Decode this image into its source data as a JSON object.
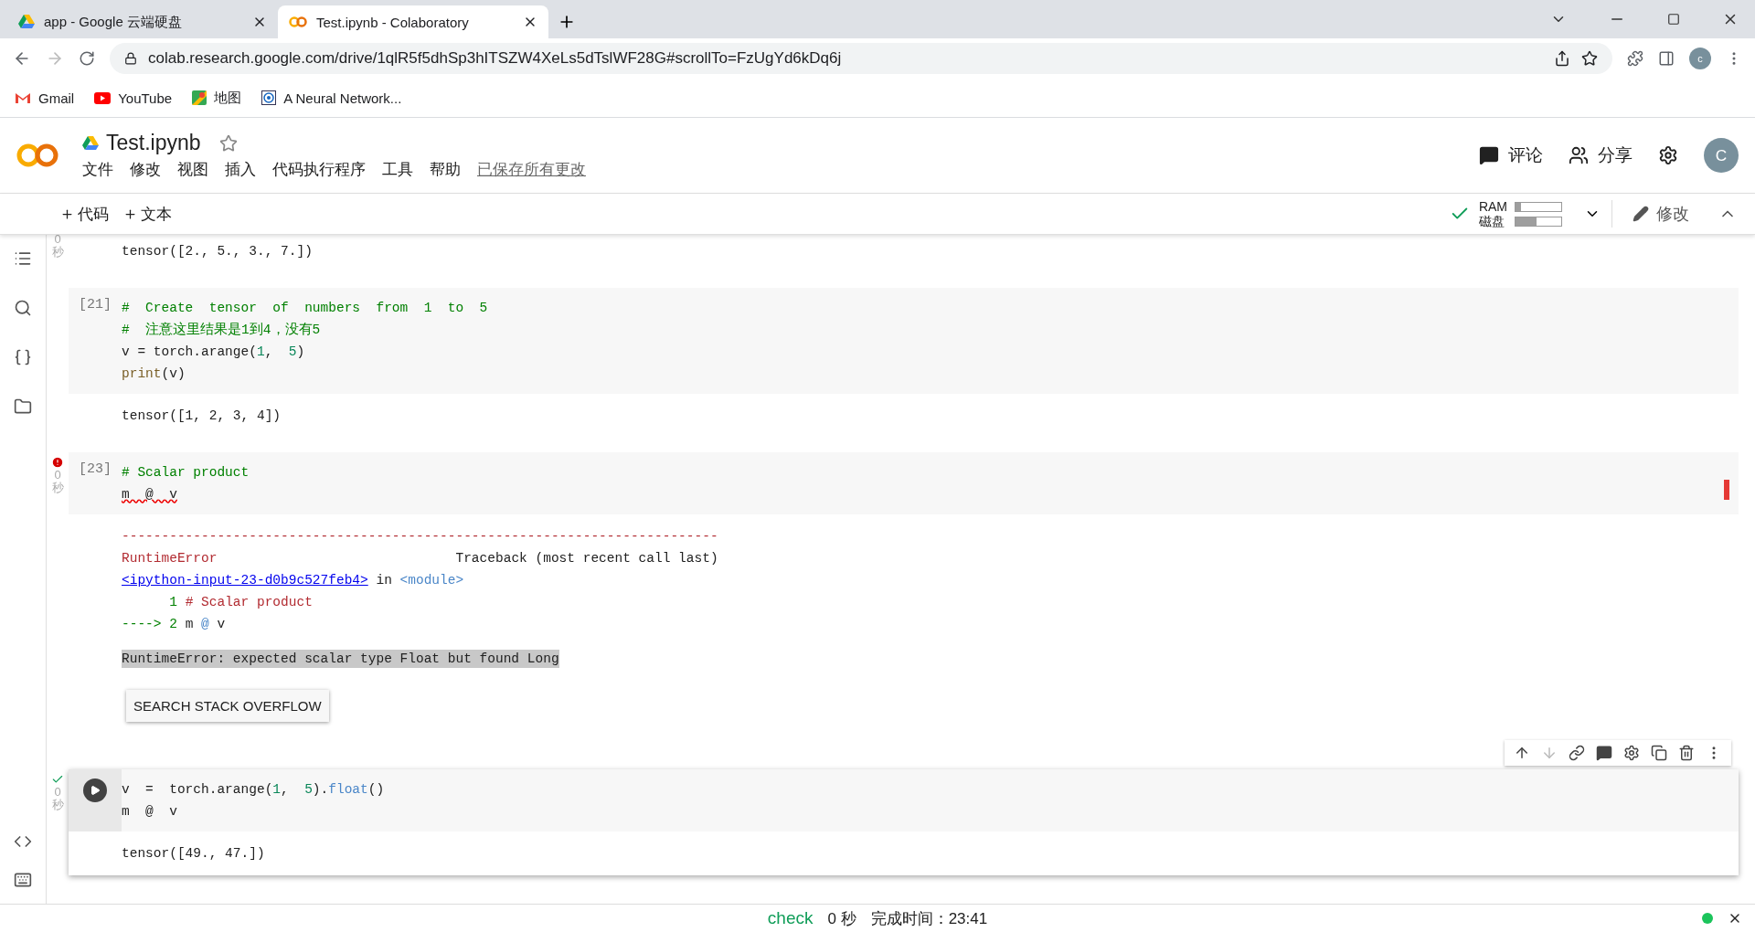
{
  "browser": {
    "tabs": [
      {
        "title": "app - Google 云端硬盘",
        "selected": false
      },
      {
        "title": "Test.ipynb - Colaboratory",
        "selected": true
      }
    ],
    "url": "colab.research.google.com/drive/1qlR5f5dhSp3hITSZW4XeLs5dTslWF28G#scrollTo=FzUgYd6kDq6j",
    "profile": "c",
    "bookmarks": [
      {
        "label": "Gmail"
      },
      {
        "label": "YouTube"
      },
      {
        "label": "地图"
      },
      {
        "label": "A Neural Network..."
      }
    ]
  },
  "notebook": {
    "title": "Test.ipynb",
    "menu": [
      "文件",
      "修改",
      "视图",
      "插入",
      "代码执行程序",
      "工具",
      "帮助"
    ],
    "saved": "已保存所有更改",
    "actions": [
      {
        "label": "评论"
      },
      {
        "label": "分享"
      }
    ],
    "avatar": "C",
    "add": [
      {
        "label": "代码"
      },
      {
        "label": "文本"
      }
    ],
    "resources": {
      "connected": true,
      "meters": [
        {
          "label": "RAM",
          "level": 0.12
        },
        {
          "label": "磁盘",
          "level": 0.45
        }
      ]
    },
    "edit": "修改"
  },
  "cells": [
    {
      "kind": "output",
      "error": false,
      "success": false,
      "active": false,
      "time": [
        "0",
        "秒"
      ],
      "output": [
        [
          {
            "t": "tensor([2., 5., 3., 7.])",
            "kind": "plain"
          }
        ]
      ]
    },
    {
      "kind": "code",
      "error": false,
      "success": false,
      "active": false,
      "count": "[21]",
      "code": [
        [
          {
            "t": "#  Create  tensor  of  numbers  from  1  to  5",
            "kind": "comment"
          }
        ],
        [
          {
            "t": "#  注意这里结果是1到4，没有5",
            "kind": "comment"
          }
        ],
        [
          {
            "t": "v = torch.arange(",
            "kind": "plain"
          },
          {
            "t": "1",
            "kind": "number"
          },
          {
            "t": ",  ",
            "kind": "plain"
          },
          {
            "t": "5",
            "kind": "number"
          },
          {
            "t": ")",
            "kind": "plain"
          }
        ],
        [
          {
            "t": "print",
            "kind": "builtin"
          },
          {
            "t": "(v)",
            "kind": "plain"
          }
        ]
      ],
      "output": [
        [
          {
            "t": "tensor([1, 2, 3, 4])",
            "kind": "plain"
          }
        ]
      ]
    },
    {
      "kind": "code",
      "error": true,
      "success": false,
      "active": false,
      "count": "[23]",
      "time": [
        "0",
        "秒"
      ],
      "code": [
        [
          {
            "t": "# Scalar product",
            "kind": "comment"
          }
        ],
        [
          {
            "t": "m  @  v",
            "kind": "squiggle"
          }
        ]
      ],
      "output": [
        [
          {
            "t": "---------------------------------------------------------------------------",
            "kind": "error"
          }
        ],
        [
          {
            "t": "RuntimeError                              ",
            "kind": "error"
          },
          {
            "t": "Traceback (most recent call last)",
            "kind": "plain"
          }
        ],
        [
          {
            "t": "<ipython-input-23-d0b9c527feb4>",
            "kind": "link"
          },
          {
            "t": " in ",
            "kind": "plain"
          },
          {
            "t": "<module>",
            "kind": "module"
          }
        ],
        [
          {
            "t": "      1 ",
            "kind": "green"
          },
          {
            "t": "# Scalar product",
            "kind": "error"
          }
        ],
        [
          {
            "t": "----> 2 ",
            "kind": "green"
          },
          {
            "t": "m ",
            "kind": "plain"
          },
          {
            "t": "@",
            "kind": "module"
          },
          {
            "t": " v",
            "kind": "plain"
          }
        ],
        [
          {
            "t": "RuntimeError: expected scalar type Float but found Long",
            "kind": "highlight"
          }
        ]
      ],
      "button": "SEARCH STACK OVERFLOW"
    },
    {
      "kind": "code",
      "error": false,
      "success": true,
      "active": true,
      "time": [
        "0",
        "秒"
      ],
      "code": [
        [
          {
            "t": "v  =  torch.arange(",
            "kind": "plain"
          },
          {
            "t": "1",
            "kind": "number"
          },
          {
            "t": ",  ",
            "kind": "plain"
          },
          {
            "t": "5",
            "kind": "number"
          },
          {
            "t": ").",
            "kind": "plain"
          },
          {
            "t": "float",
            "kind": "module"
          },
          {
            "t": "()",
            "kind": "plain"
          }
        ],
        [
          {
            "t": "m  @  v",
            "kind": "plain"
          }
        ]
      ],
      "output": [
        [
          {
            "t": "tensor([49., 47.])",
            "kind": "plain"
          }
        ]
      ]
    }
  ],
  "status_bar": {
    "check": "check",
    "duration": "0 秒",
    "finished": "完成时间：23:41",
    "connected": true
  }
}
